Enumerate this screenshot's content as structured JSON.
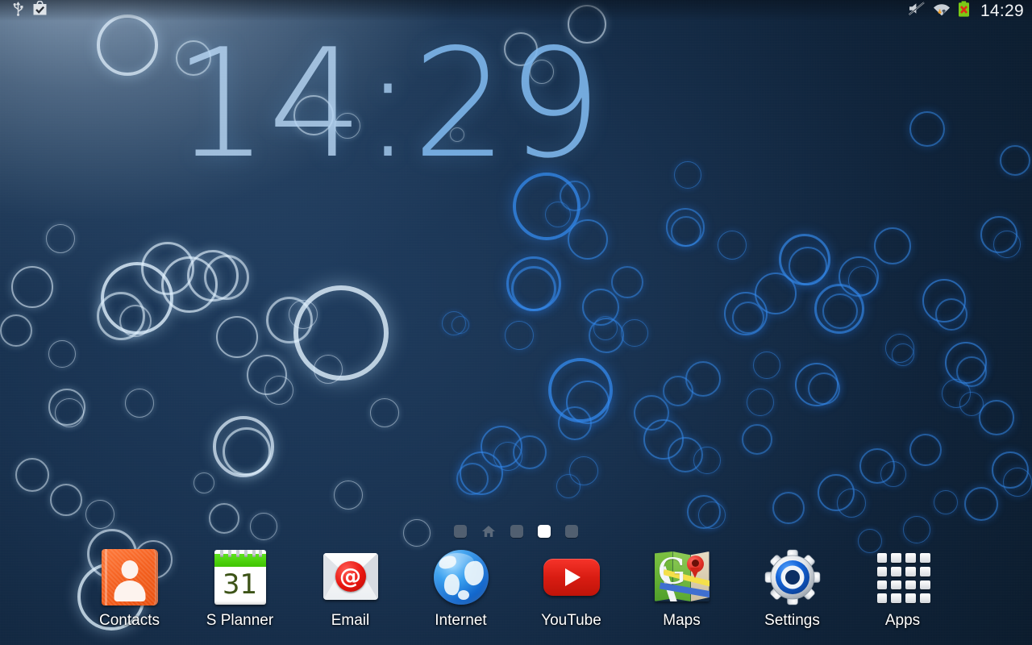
{
  "statusbar": {
    "left_icons": [
      {
        "name": "usb-icon",
        "label": "USB connected"
      },
      {
        "name": "play-store-update-icon",
        "label": "App update available"
      }
    ],
    "right_icons": [
      {
        "name": "sound-muted-icon",
        "label": "Sound muted"
      },
      {
        "name": "wifi-icon",
        "label": "Wi-Fi connected"
      },
      {
        "name": "battery-error-icon",
        "label": "Battery not charging"
      }
    ],
    "time": "14:29"
  },
  "clock_widget": {
    "hours": "14",
    "separator": ":",
    "minutes": "29",
    "full_time": "14:29",
    "color": "#a8cef0"
  },
  "page_indicator": {
    "pages": [
      {
        "type": "dot",
        "active": false
      },
      {
        "type": "home",
        "active": false
      },
      {
        "type": "dot",
        "active": false
      },
      {
        "type": "dot",
        "active": true
      },
      {
        "type": "dot",
        "active": false
      }
    ],
    "active_index": 3,
    "count": 5
  },
  "dock": {
    "apps": [
      {
        "label": "Contacts",
        "icon": "contacts-icon"
      },
      {
        "label": "S Planner",
        "icon": "calendar-icon",
        "day": "31"
      },
      {
        "label": "Email",
        "icon": "email-icon",
        "glyph": "@"
      },
      {
        "label": "Internet",
        "icon": "globe-icon"
      },
      {
        "label": "YouTube",
        "icon": "youtube-icon"
      },
      {
        "label": "Maps",
        "icon": "maps-icon",
        "glyph": "G"
      },
      {
        "label": "Settings",
        "icon": "gear-icon"
      },
      {
        "label": "Apps",
        "icon": "apps-grid-icon"
      }
    ]
  },
  "wallpaper": {
    "name": "bubbles-live-wallpaper",
    "background_colors": [
      "#95acc4",
      "#1d3a5c",
      "#0a1c30",
      "#050f1c"
    ],
    "bubble_color_light": "#cfe6f8",
    "bubble_color_blue": "#2b7ce0"
  }
}
